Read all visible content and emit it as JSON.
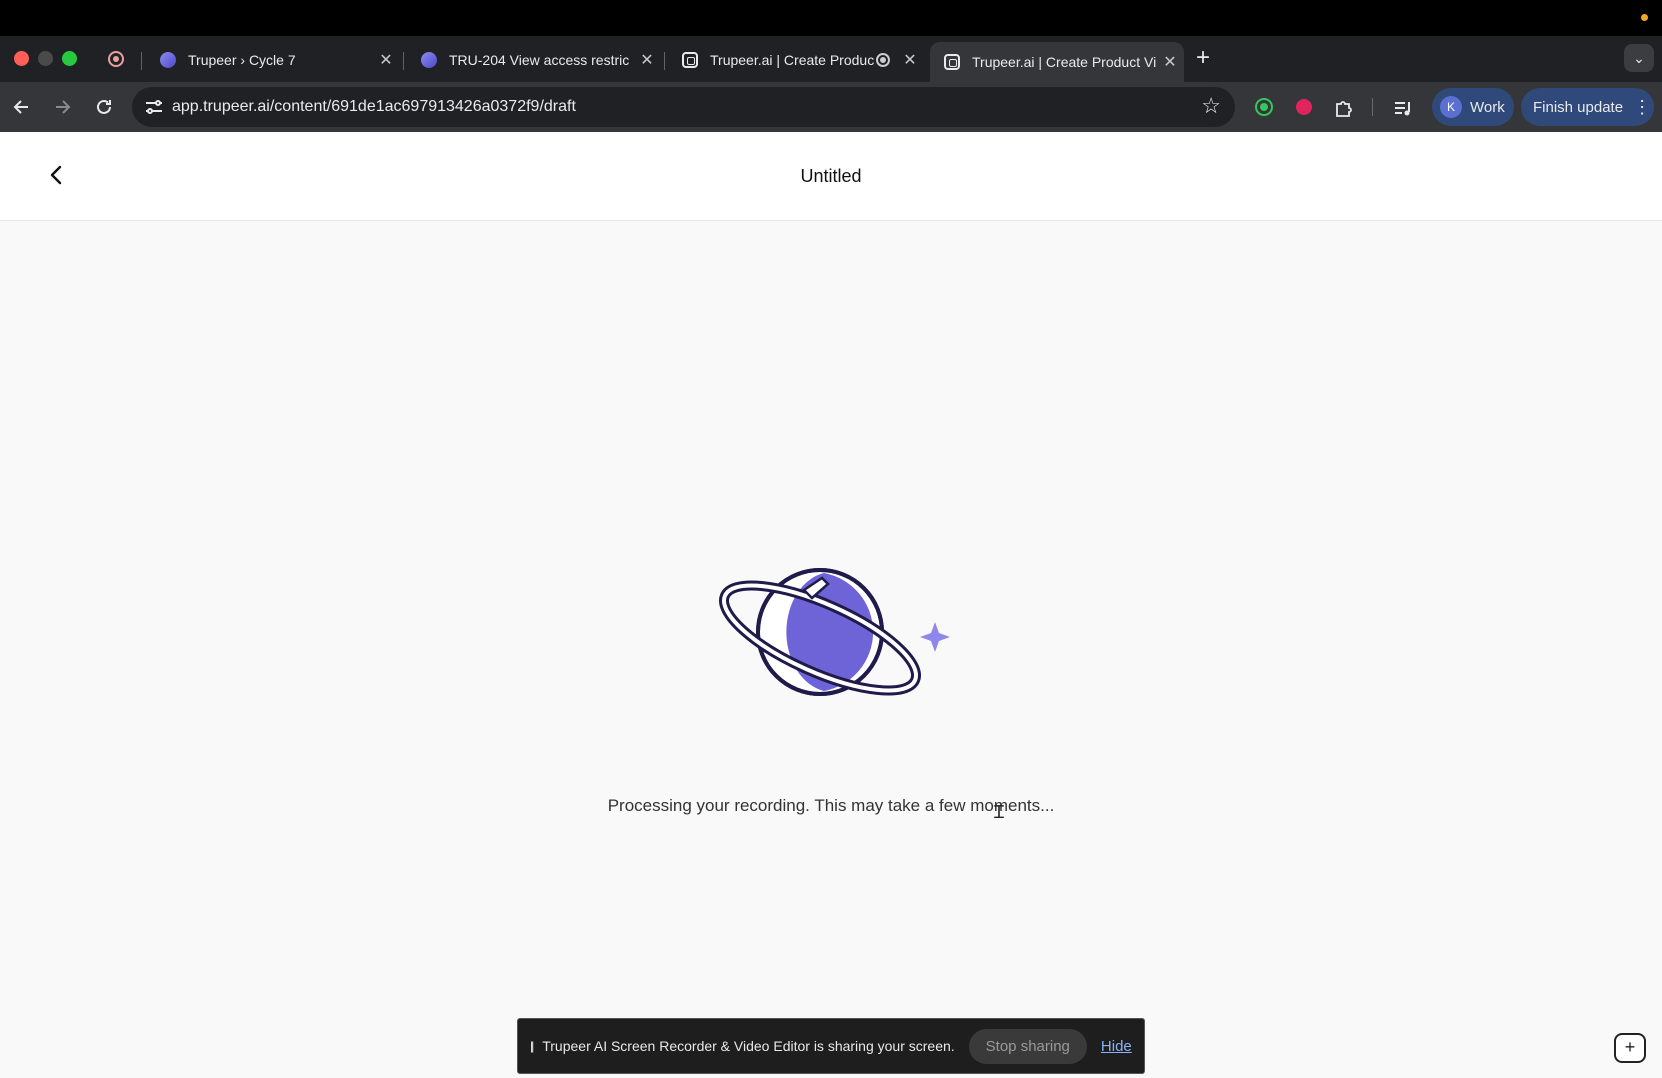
{
  "browser": {
    "tabs": [
      {
        "title": "Trupeer › Cycle 7",
        "icon": "linear-icon",
        "close": "✕"
      },
      {
        "title": "TRU-204 View access restric",
        "icon": "linear-icon",
        "close": "✕"
      },
      {
        "title": "Trupeer.ai | Create Produc",
        "icon": "trupeer-icon",
        "close": "✕"
      },
      {
        "title": "Trupeer.ai | Create Product Vi",
        "icon": "trupeer-icon",
        "close": "✕"
      }
    ],
    "new_tab": "+",
    "tab_search": "⌄",
    "url": "app.trupeer.ai/content/691de1ac697913426a0372f9/draft",
    "profile_initial": "K",
    "profile_name": "Work",
    "finish_update": "Finish update",
    "colors": {
      "profile_bg": "#2f4a7a",
      "ext_green": "#34c759",
      "ext_red": "#e0245e"
    }
  },
  "app": {
    "title": "Untitled",
    "status_message": "Processing your recording. This may take a few moments...",
    "colors": {
      "planet": "#6e64d8",
      "outline": "#1f1b4a",
      "sparkle": "#8f87ea"
    }
  },
  "share_bar": {
    "pause_glyph": "||",
    "message": "Trupeer AI Screen Recorder & Video Editor is sharing your screen.",
    "stop_label": "Stop sharing",
    "hide_label": "Hide"
  },
  "corner_button": "+"
}
